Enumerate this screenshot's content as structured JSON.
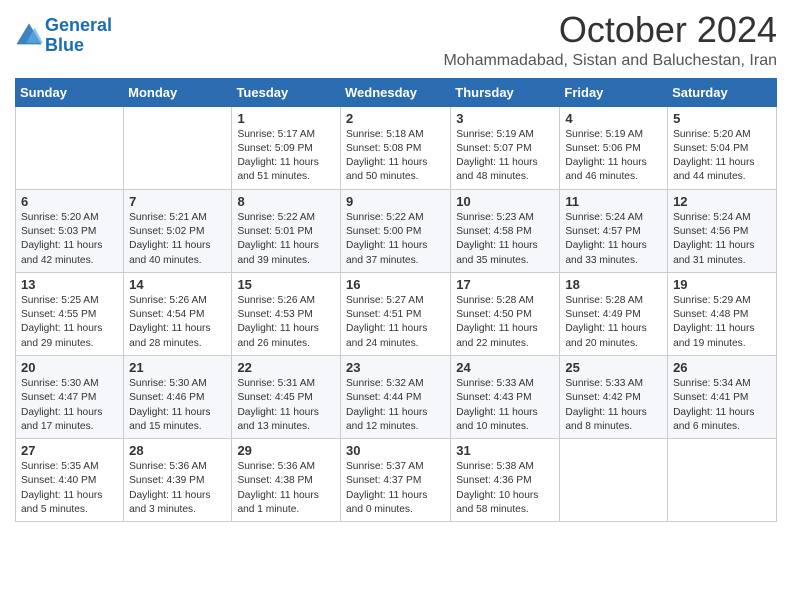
{
  "logo": {
    "line1": "General",
    "line2": "Blue"
  },
  "title": "October 2024",
  "location": "Mohammadabad, Sistan and Baluchestan, Iran",
  "weekdays": [
    "Sunday",
    "Monday",
    "Tuesday",
    "Wednesday",
    "Thursday",
    "Friday",
    "Saturday"
  ],
  "weeks": [
    [
      {
        "day": "",
        "info": ""
      },
      {
        "day": "",
        "info": ""
      },
      {
        "day": "1",
        "info": "Sunrise: 5:17 AM\nSunset: 5:09 PM\nDaylight: 11 hours and 51 minutes."
      },
      {
        "day": "2",
        "info": "Sunrise: 5:18 AM\nSunset: 5:08 PM\nDaylight: 11 hours and 50 minutes."
      },
      {
        "day": "3",
        "info": "Sunrise: 5:19 AM\nSunset: 5:07 PM\nDaylight: 11 hours and 48 minutes."
      },
      {
        "day": "4",
        "info": "Sunrise: 5:19 AM\nSunset: 5:06 PM\nDaylight: 11 hours and 46 minutes."
      },
      {
        "day": "5",
        "info": "Sunrise: 5:20 AM\nSunset: 5:04 PM\nDaylight: 11 hours and 44 minutes."
      }
    ],
    [
      {
        "day": "6",
        "info": "Sunrise: 5:20 AM\nSunset: 5:03 PM\nDaylight: 11 hours and 42 minutes."
      },
      {
        "day": "7",
        "info": "Sunrise: 5:21 AM\nSunset: 5:02 PM\nDaylight: 11 hours and 40 minutes."
      },
      {
        "day": "8",
        "info": "Sunrise: 5:22 AM\nSunset: 5:01 PM\nDaylight: 11 hours and 39 minutes."
      },
      {
        "day": "9",
        "info": "Sunrise: 5:22 AM\nSunset: 5:00 PM\nDaylight: 11 hours and 37 minutes."
      },
      {
        "day": "10",
        "info": "Sunrise: 5:23 AM\nSunset: 4:58 PM\nDaylight: 11 hours and 35 minutes."
      },
      {
        "day": "11",
        "info": "Sunrise: 5:24 AM\nSunset: 4:57 PM\nDaylight: 11 hours and 33 minutes."
      },
      {
        "day": "12",
        "info": "Sunrise: 5:24 AM\nSunset: 4:56 PM\nDaylight: 11 hours and 31 minutes."
      }
    ],
    [
      {
        "day": "13",
        "info": "Sunrise: 5:25 AM\nSunset: 4:55 PM\nDaylight: 11 hours and 29 minutes."
      },
      {
        "day": "14",
        "info": "Sunrise: 5:26 AM\nSunset: 4:54 PM\nDaylight: 11 hours and 28 minutes."
      },
      {
        "day": "15",
        "info": "Sunrise: 5:26 AM\nSunset: 4:53 PM\nDaylight: 11 hours and 26 minutes."
      },
      {
        "day": "16",
        "info": "Sunrise: 5:27 AM\nSunset: 4:51 PM\nDaylight: 11 hours and 24 minutes."
      },
      {
        "day": "17",
        "info": "Sunrise: 5:28 AM\nSunset: 4:50 PM\nDaylight: 11 hours and 22 minutes."
      },
      {
        "day": "18",
        "info": "Sunrise: 5:28 AM\nSunset: 4:49 PM\nDaylight: 11 hours and 20 minutes."
      },
      {
        "day": "19",
        "info": "Sunrise: 5:29 AM\nSunset: 4:48 PM\nDaylight: 11 hours and 19 minutes."
      }
    ],
    [
      {
        "day": "20",
        "info": "Sunrise: 5:30 AM\nSunset: 4:47 PM\nDaylight: 11 hours and 17 minutes."
      },
      {
        "day": "21",
        "info": "Sunrise: 5:30 AM\nSunset: 4:46 PM\nDaylight: 11 hours and 15 minutes."
      },
      {
        "day": "22",
        "info": "Sunrise: 5:31 AM\nSunset: 4:45 PM\nDaylight: 11 hours and 13 minutes."
      },
      {
        "day": "23",
        "info": "Sunrise: 5:32 AM\nSunset: 4:44 PM\nDaylight: 11 hours and 12 minutes."
      },
      {
        "day": "24",
        "info": "Sunrise: 5:33 AM\nSunset: 4:43 PM\nDaylight: 11 hours and 10 minutes."
      },
      {
        "day": "25",
        "info": "Sunrise: 5:33 AM\nSunset: 4:42 PM\nDaylight: 11 hours and 8 minutes."
      },
      {
        "day": "26",
        "info": "Sunrise: 5:34 AM\nSunset: 4:41 PM\nDaylight: 11 hours and 6 minutes."
      }
    ],
    [
      {
        "day": "27",
        "info": "Sunrise: 5:35 AM\nSunset: 4:40 PM\nDaylight: 11 hours and 5 minutes."
      },
      {
        "day": "28",
        "info": "Sunrise: 5:36 AM\nSunset: 4:39 PM\nDaylight: 11 hours and 3 minutes."
      },
      {
        "day": "29",
        "info": "Sunrise: 5:36 AM\nSunset: 4:38 PM\nDaylight: 11 hours and 1 minute."
      },
      {
        "day": "30",
        "info": "Sunrise: 5:37 AM\nSunset: 4:37 PM\nDaylight: 11 hours and 0 minutes."
      },
      {
        "day": "31",
        "info": "Sunrise: 5:38 AM\nSunset: 4:36 PM\nDaylight: 10 hours and 58 minutes."
      },
      {
        "day": "",
        "info": ""
      },
      {
        "day": "",
        "info": ""
      }
    ]
  ]
}
